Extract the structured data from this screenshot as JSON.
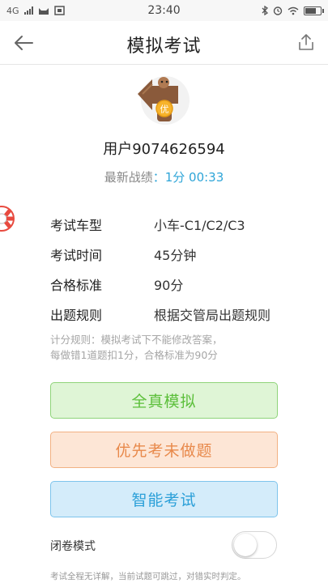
{
  "status_bar": {
    "network": "4G",
    "time": "23:40",
    "icons": [
      "signal-icon",
      "cat-icon",
      "notification-icon",
      "bluetooth-icon",
      "alarm-icon",
      "wifi-icon",
      "battery-icon"
    ],
    "battery_level": 0.75
  },
  "nav": {
    "title": "模拟考试",
    "back_icon": "arrow-left-icon",
    "share_icon": "share-icon"
  },
  "profile": {
    "mascot_badge": "优",
    "username": "用户9074626594",
    "record_label": "最新战绩",
    "record_value": "：1分 00:33"
  },
  "info": [
    {
      "key": "考试车型",
      "value": "小车-C1/C2/C3"
    },
    {
      "key": "考试时间",
      "value": "45分钟"
    },
    {
      "key": "合格标准",
      "value": "90分"
    },
    {
      "key": "出题规则",
      "value": "根据交管局出题规则"
    }
  ],
  "rules": {
    "line1": "计分规则：模拟考试下不能修改答案，",
    "line2": "每做错1道题扣1分，合格标准为90分"
  },
  "buttons": {
    "real_mode": "全真模拟",
    "unanswered_first": "优先考未做题",
    "smart_exam": "智能考试"
  },
  "closed_mode": {
    "label": "闭卷模式",
    "enabled": false
  },
  "footnote": "考试全程无详解，当前试题可跳过，对错实时判定。",
  "colors": {
    "green": "#5bbf3a",
    "orange": "#e8894b",
    "blue": "#2a9fd8",
    "accent_text": "#2ea5d8"
  }
}
